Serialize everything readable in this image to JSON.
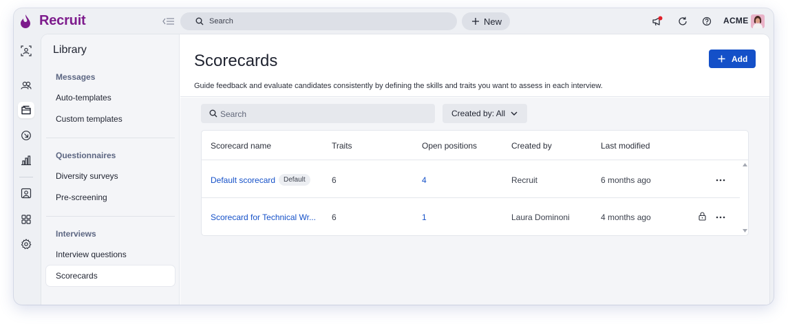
{
  "app": {
    "brand": "Recruit",
    "org_label": "ACME",
    "colors": {
      "brand": "#7d1b8c",
      "accent": "#1450c8",
      "notification": "#e0202a"
    }
  },
  "topbar": {
    "search_placeholder": "Search",
    "new_label": "New",
    "icons": [
      "collapse-sidebar-icon",
      "search-icon",
      "plus-icon",
      "megaphone-icon",
      "refresh-icon",
      "help-icon"
    ]
  },
  "rail": {
    "icons": [
      "candidate-search-icon",
      "people-icon",
      "library-icon",
      "inbox-icon",
      "reports-icon",
      "contacts-icon",
      "apps-grid-icon",
      "settings-icon"
    ],
    "active": "library-icon"
  },
  "subnav": {
    "title": "Library",
    "sections": [
      {
        "heading": "Messages",
        "items": [
          "Auto-templates",
          "Custom templates"
        ]
      },
      {
        "heading": "Questionnaires",
        "items": [
          "Diversity surveys",
          "Pre-screening"
        ]
      },
      {
        "heading": "Interviews",
        "items": [
          "Interview questions",
          "Scorecards"
        ]
      }
    ],
    "active_item": "Scorecards"
  },
  "main": {
    "title": "Scorecards",
    "description": "Guide feedback and evaluate candidates consistently by defining the skills and traits you want to assess in each interview.",
    "add_label": "Add",
    "search_placeholder": "Search",
    "created_by_filter": "Created by: All",
    "table": {
      "columns": [
        "Scorecard name",
        "Traits",
        "Open positions",
        "Created by",
        "Last modified"
      ],
      "rows": [
        {
          "name": "Default scorecard",
          "badge": "Default",
          "traits": "6",
          "open_positions": "4",
          "created_by": "Recruit",
          "last_modified": "6 months ago",
          "locked": false
        },
        {
          "name": "Scorecard for Technical Wr...",
          "badge": "",
          "traits": "6",
          "open_positions": "1",
          "created_by": "Laura Dominoni",
          "last_modified": "4 months ago",
          "locked": true
        }
      ]
    }
  }
}
